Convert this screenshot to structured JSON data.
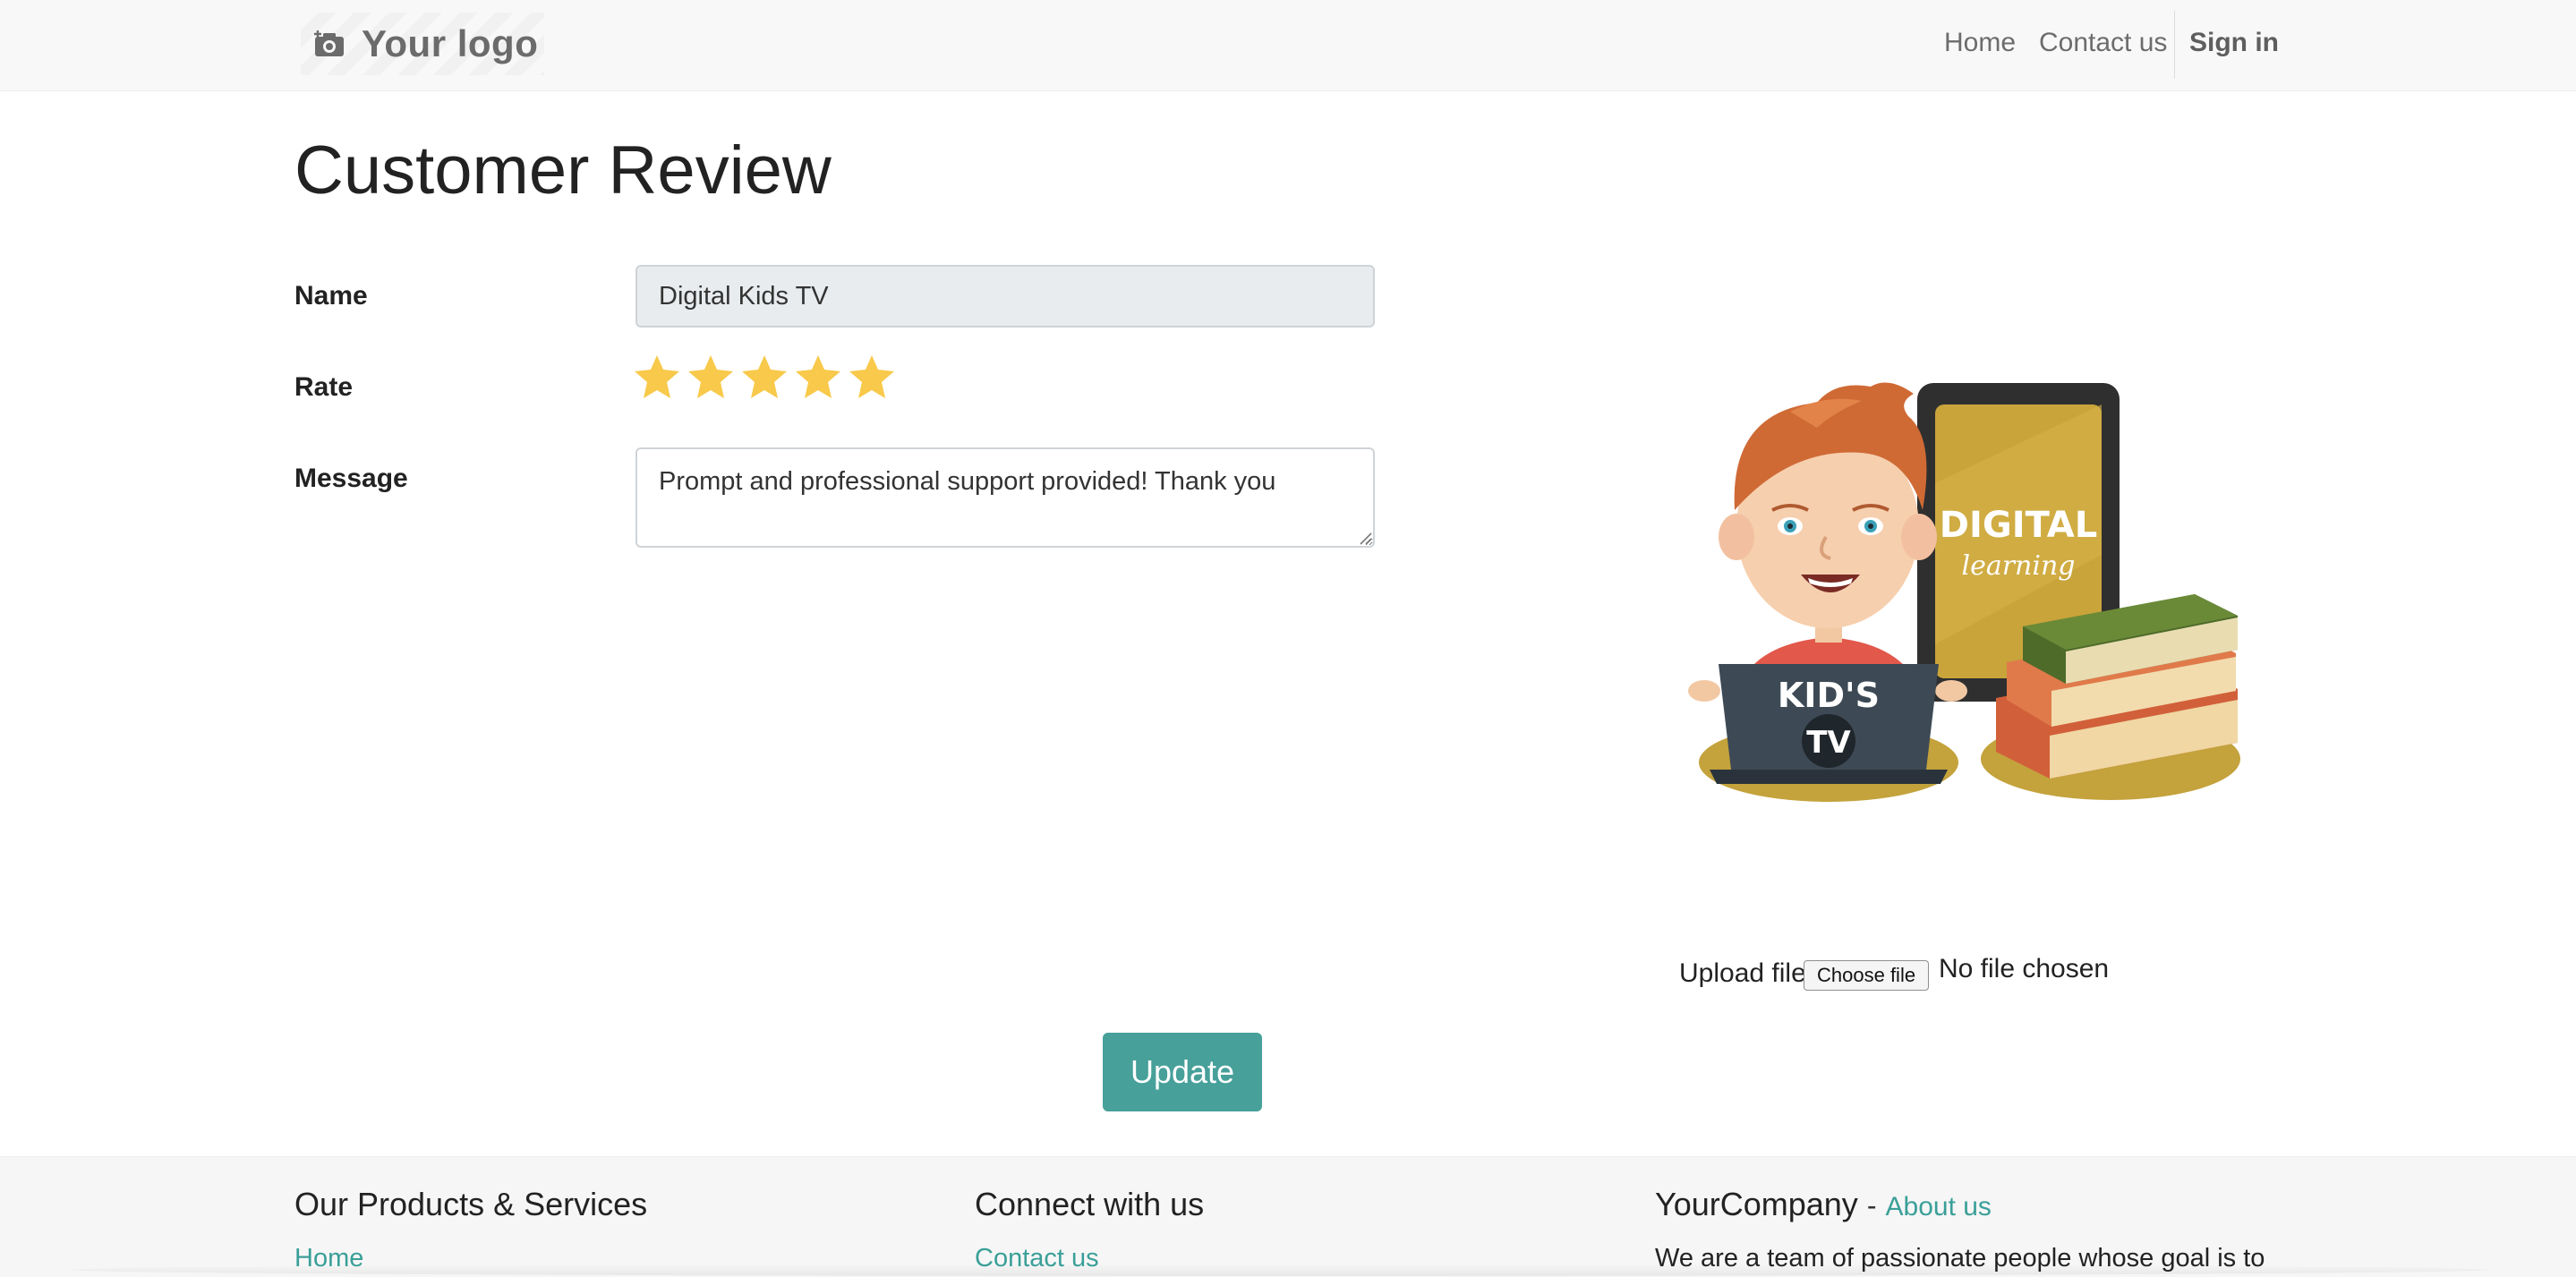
{
  "navbar": {
    "logo_text": "Your logo",
    "logo_icon": "camera-icon",
    "links": [
      "Home",
      "Contact us"
    ],
    "sign_in": "Sign in"
  },
  "page": {
    "title": "Customer Review"
  },
  "form": {
    "name_label": "Name",
    "name_value": "Digital Kids TV",
    "rate_label": "Rate",
    "rating": 5,
    "rating_max": 5,
    "message_label": "Message",
    "message_value": "Prompt and professional support provided! Thank you"
  },
  "illustration": {
    "tablet_title": "DIGITAL",
    "tablet_subtitle": "learning",
    "laptop_line1": "KID'S",
    "laptop_line2": "TV"
  },
  "upload": {
    "label": "Upload file",
    "button": "Choose file",
    "status": "No file chosen"
  },
  "actions": {
    "update": "Update"
  },
  "footer": {
    "col1_title": "Our Products & Services",
    "col1_link": "Home",
    "col2_title": "Connect with us",
    "col2_link": "Contact us",
    "col3_title": "YourCompany",
    "col3_sep": "-",
    "col3_about": "About us",
    "col3_text": "We are a team of passionate people whose goal is to"
  },
  "colors": {
    "accent": "#47a09a",
    "star": "#f8c94a",
    "navbar_bg": "#f8f8f8"
  }
}
